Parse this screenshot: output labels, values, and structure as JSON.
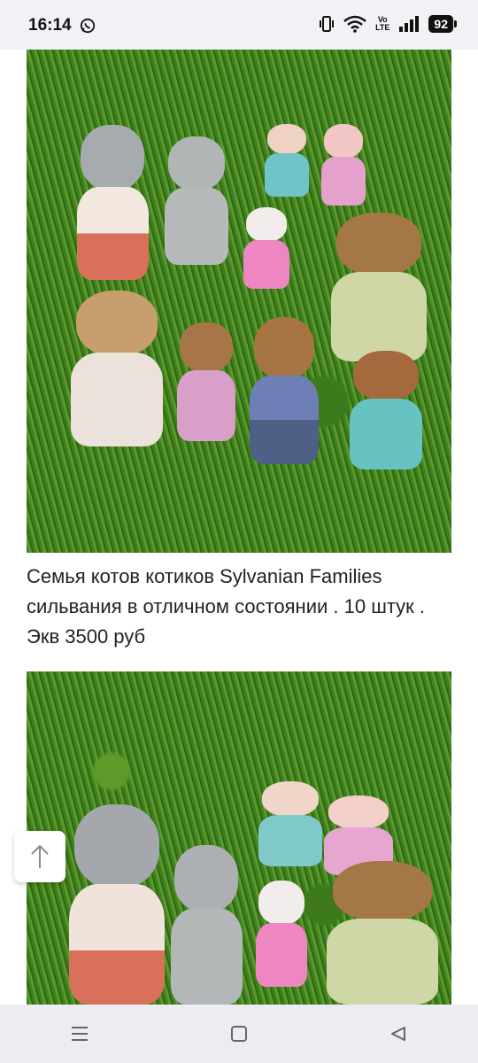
{
  "status_bar": {
    "time": "16:14",
    "volte_line1": "Vo",
    "volte_line2": "LTE",
    "battery": "92"
  },
  "post": {
    "caption": "Семья котов котиков Sylvanian Families сильвания в отличном состоянии . 10 штук . Экв 3500 руб"
  },
  "icons": {
    "whatsapp": "whatsapp-icon",
    "vibrate": "vibrate-icon",
    "wifi": "wifi-icon",
    "signal": "signal-icon",
    "scroll_top": "arrow-up-icon",
    "nav_recents": "menu-lines-icon",
    "nav_home": "square-icon",
    "nav_back": "triangle-back-icon"
  },
  "colors": {
    "grass": "#4a8a22",
    "status_bar_bg": "#f2f2f6",
    "nav_bar_bg": "#ececf2",
    "text": "#222222"
  }
}
